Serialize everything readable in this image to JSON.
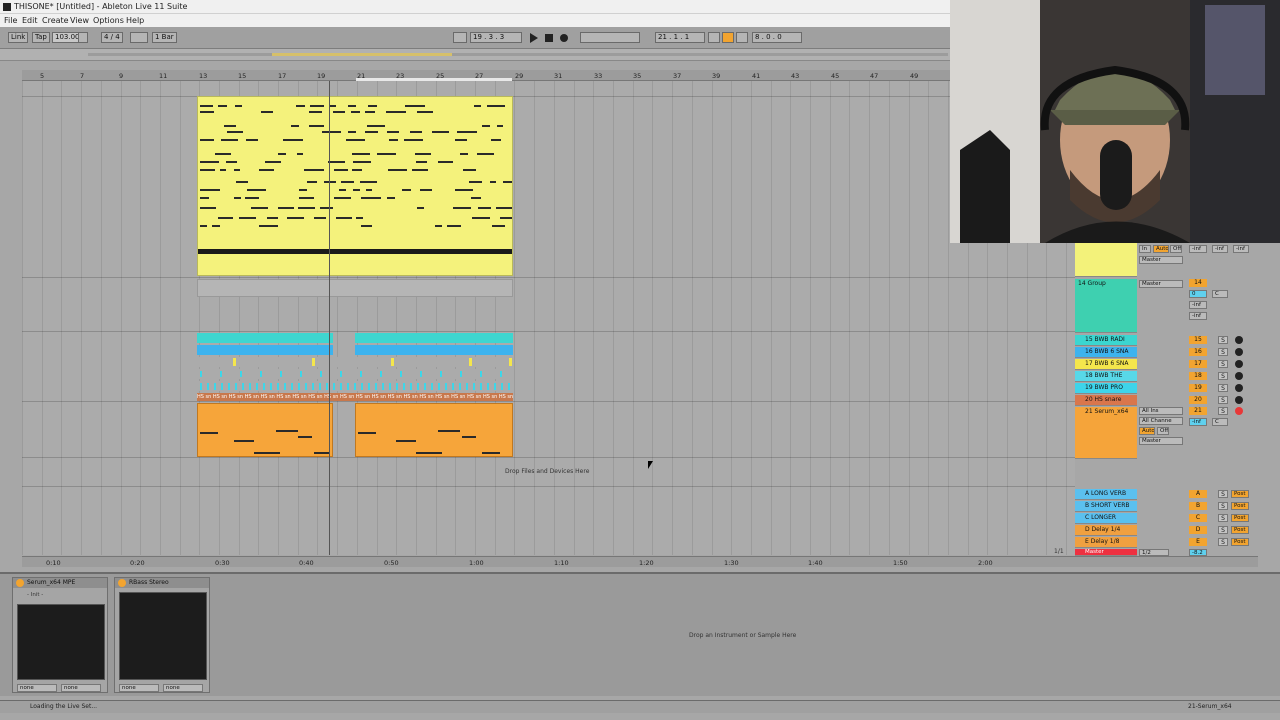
{
  "window": {
    "title": "THISONE* [Untitled] - Ableton Live 11 Suite"
  },
  "menu": [
    "File",
    "Edit",
    "Create",
    "View",
    "Options",
    "Help"
  ],
  "controlbar": {
    "link": "Link",
    "tap": "Tap",
    "tempo": "103.00",
    "time_sig": "4 / 4",
    "quantize": "1 Bar",
    "arrangement_position": "19 .   3 .   3",
    "loop_start": "21 .   1 .   1",
    "loop_length": "8 .   0 .   0"
  },
  "bar_ruler": [
    "5",
    "7",
    "9",
    "11",
    "13",
    "15",
    "17",
    "19",
    "21",
    "23",
    "25",
    "27",
    "29",
    "31",
    "33",
    "35",
    "37",
    "39",
    "41",
    "43",
    "45",
    "47",
    "49"
  ],
  "time_ruler": [
    "0:10",
    "0:20",
    "0:30",
    "0:40",
    "0:50",
    "1:00",
    "1:10",
    "1:20",
    "1:30",
    "1:40",
    "1:50",
    "2:00"
  ],
  "arrangement": {
    "drop_hint": "Drop Files and Devices Here",
    "drum_clip_label": "HS sn"
  },
  "mixer": {
    "tracks": [
      {
        "name": "",
        "color": "#f3f27a",
        "number": "",
        "input": "In",
        "auto": "Auto",
        "off": "Off",
        "output": "Master",
        "vol": "-inf",
        "pan": "-inf",
        "send": "-inf"
      },
      {
        "name": "14 Group",
        "color": "#3ed0b0",
        "number": "14",
        "output": "Master",
        "vol": "0",
        "pan": "C",
        "send": "-inf",
        "send2": "-inf"
      },
      {
        "name": "15 BWB RADI",
        "color": "#3bd6d0",
        "number": "15",
        "s": "S"
      },
      {
        "name": "16 BWB 6 SNA",
        "color": "#3db3ee",
        "number": "16",
        "s": "S"
      },
      {
        "name": "17 BWB 6 SNA",
        "color": "#f4e64c",
        "number": "17",
        "s": "S"
      },
      {
        "name": "18 BWB THE",
        "color": "#58d8e8",
        "number": "18",
        "s": "S"
      },
      {
        "name": "19 BWB PRO",
        "color": "#3ed4ea",
        "number": "19",
        "s": "S"
      },
      {
        "name": "20 HS snare",
        "color": "#d9764c",
        "number": "20",
        "s": "S"
      },
      {
        "name": "21 Serum_x64",
        "color": "#f5a43a",
        "number": "21",
        "s": "S",
        "input": "All Ins",
        "input_ch": "All Channe",
        "auto": "Auto",
        "off": "Off",
        "output": "Master",
        "vol": "-inf",
        "pan": "C"
      }
    ],
    "returns": [
      {
        "name": "A LONG VERB",
        "color": "#5bc0ee",
        "letter": "A",
        "post": "Post"
      },
      {
        "name": "B SHORT VERB",
        "color": "#5bc0ee",
        "letter": "B",
        "post": "Post"
      },
      {
        "name": "C LONGER",
        "color": "#5bc0ee",
        "letter": "C",
        "post": "Post"
      },
      {
        "name": "D Delay 1/4",
        "color": "#f0a040",
        "letter": "D",
        "post": "Post"
      },
      {
        "name": "E Delay 1/8",
        "color": "#f0a040",
        "letter": "E",
        "post": "Post"
      }
    ],
    "master": {
      "name": "Master",
      "color": "#ee3040",
      "output": "1/2",
      "vol": "-8.2",
      "pos": "1/1"
    }
  },
  "devices": {
    "serum": {
      "title": "Serum_x64 MPE",
      "preset": "- Init -",
      "in": "none",
      "out": "none"
    },
    "rbass": {
      "title": "RBass Stereo",
      "in": "none",
      "out": "none"
    },
    "drop_hint": "Drop an Instrument or Sample Here"
  },
  "status": {
    "message": "Loading the Live Set...",
    "selected_track": "21-Serum_x64"
  }
}
